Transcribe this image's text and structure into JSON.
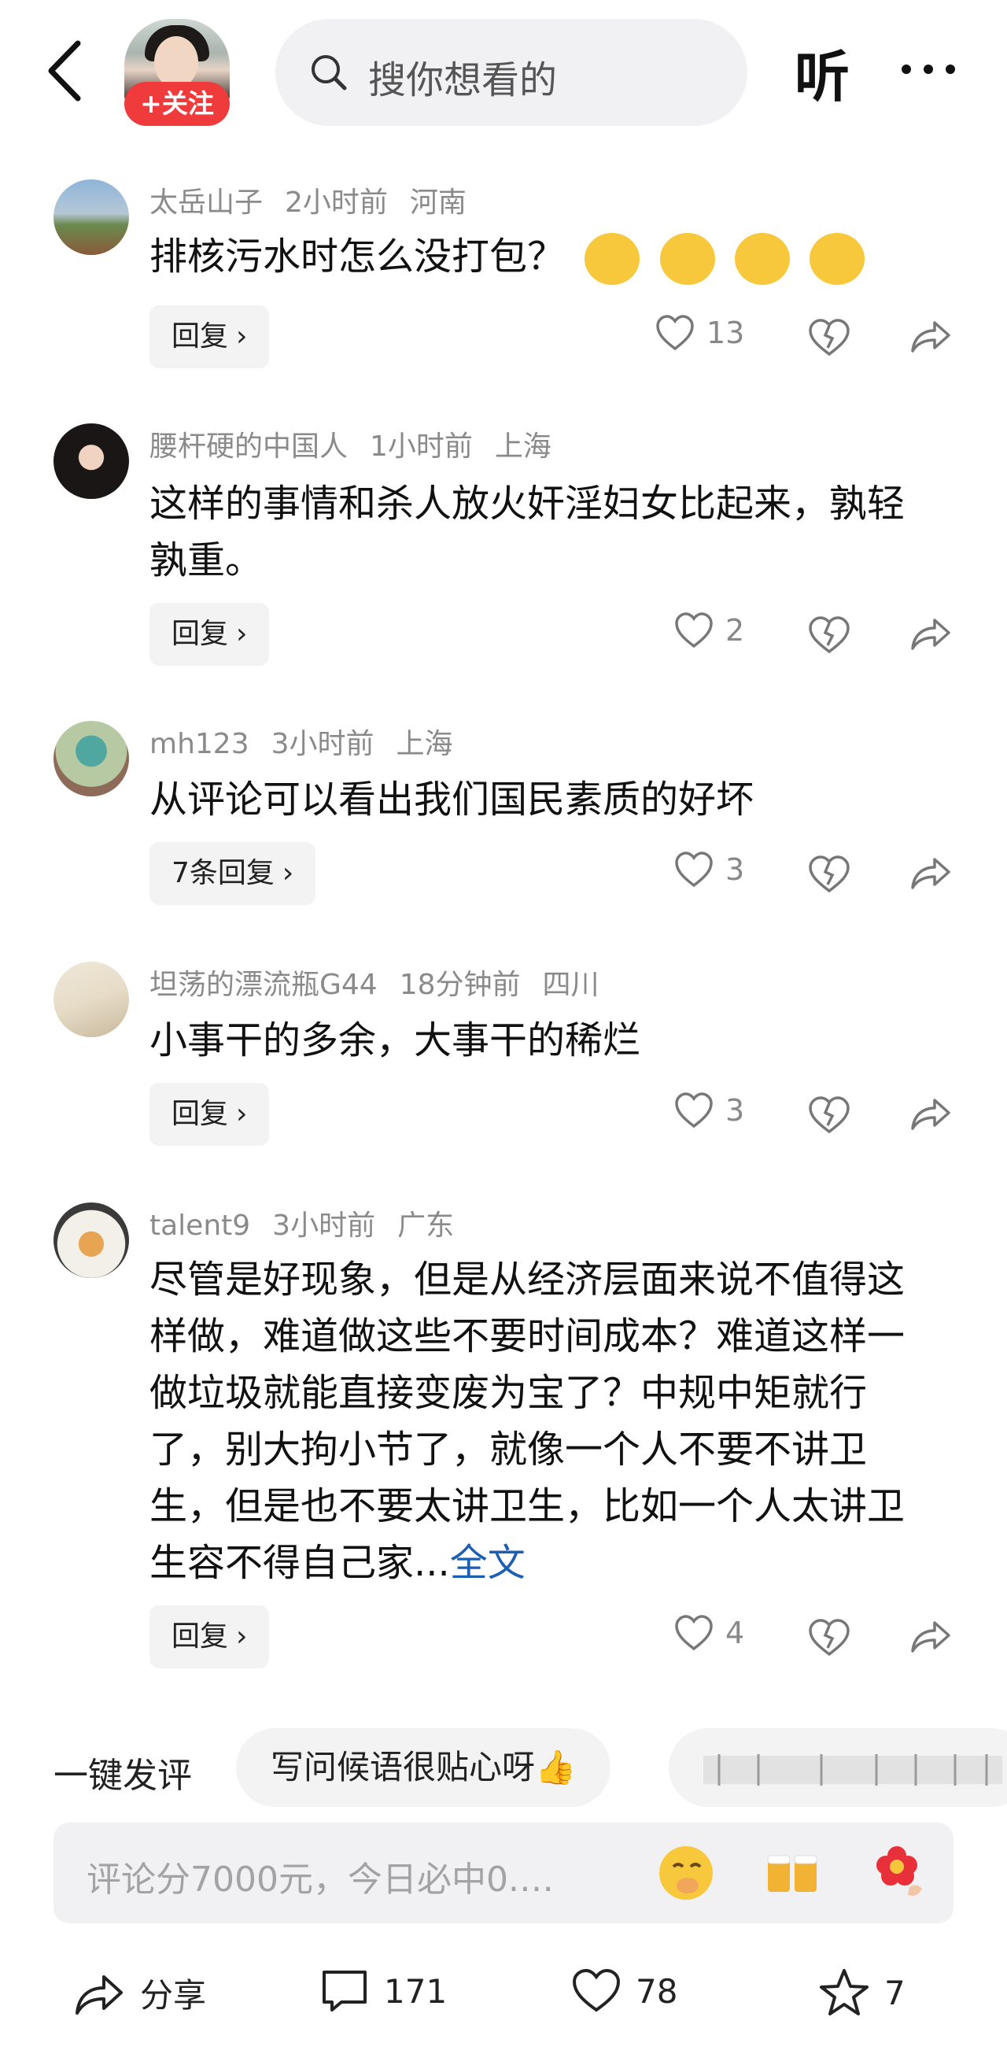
{
  "header": {
    "follow_label": "+关注",
    "search_placeholder": "搜你想看的",
    "listen_label": "听"
  },
  "comments": [
    {
      "user": "太岳山子",
      "time": "2小时前",
      "location": "河南",
      "text": "排核污水时怎么没打包？",
      "emoji_count": 4,
      "reply_label": "回复",
      "likes": "13"
    },
    {
      "user": "腰杆硬的中国人",
      "time": "1小时前",
      "location": "上海",
      "text": "这样的事情和杀人放火奸淫妇女比起来，孰轻孰重。",
      "reply_label": "回复",
      "likes": "2"
    },
    {
      "user": "mh123",
      "time": "3小时前",
      "location": "上海",
      "text": "从评论可以看出我们国民素质的好坏",
      "reply_label": "7条回复",
      "likes": "3"
    },
    {
      "user": "坦荡的漂流瓶G44",
      "time": "18分钟前",
      "location": "四川",
      "text": "小事干的多余，大事干的稀烂",
      "reply_label": "回复",
      "likes": "3"
    },
    {
      "user": "talent9",
      "time": "3小时前",
      "location": "广东",
      "text": "尽管是好现象，但是从经济层面来说不值得这样做，难道做这些不要时间成本？难道这样一做垃圾就能直接变废为宝了？中规中矩就行了，别大拘小节了，就像一个人不要不讲卫生，但是也不要太讲卫生，比如一个人太讲卫生容不得自己家...",
      "full_label": "全文",
      "reply_label": "回复",
      "likes": "4"
    }
  ],
  "quick_comment": {
    "label": "一键发评",
    "chips": [
      "写问候语很贴心呀👍"
    ]
  },
  "input": {
    "placeholder": "评论分7000元，今日必中0.…"
  },
  "bottom_bar": {
    "share_label": "分享",
    "comments_count": "171",
    "likes_count": "78",
    "favorites_count": "7"
  },
  "colors": {
    "follow_red": "#ef3b3b",
    "link_blue": "#1a5fb4",
    "meta_gray": "#8a8a8a"
  }
}
